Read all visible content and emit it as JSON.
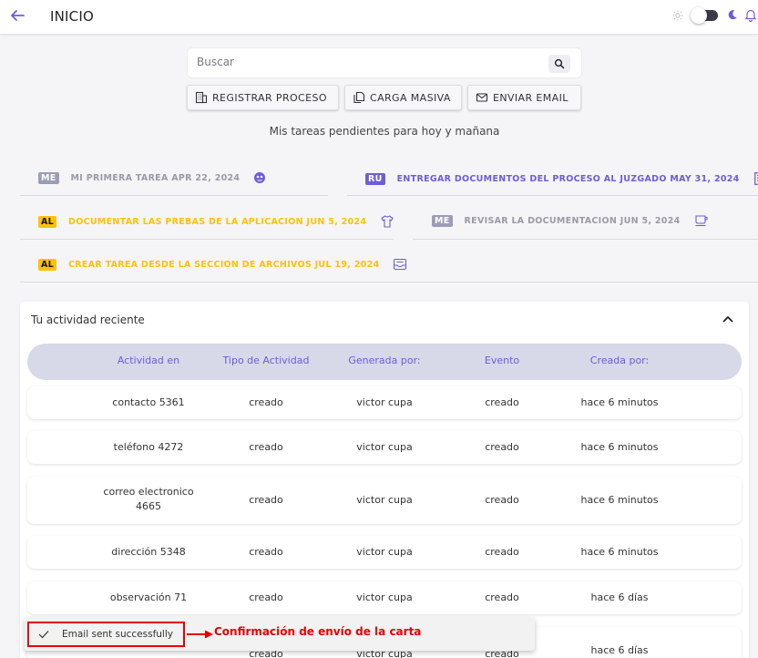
{
  "header": {
    "title": "INICIO"
  },
  "search": {
    "placeholder": "Buscar"
  },
  "actions": [
    {
      "label": "REGISTRAR PROCESO",
      "icon": "building-icon"
    },
    {
      "label": "CARGA MASIVA",
      "icon": "documents-icon"
    },
    {
      "label": "ENVIAR EMAIL",
      "icon": "envelope-icon"
    }
  ],
  "pending_title": "Mis tareas pendientes para hoy y mañana",
  "tasks": [
    {
      "badge": "ME",
      "text": "MI PRIMERA TAREA APR 22, 2024",
      "icon": "face-icon"
    },
    {
      "badge": "RU",
      "text": "ENTREGAR DOCUMENTOS DEL PROCESO AL JUZGADO MAY 31, 2024",
      "icon": "building-icon"
    },
    {
      "badge": "AL",
      "text": "DOCUMENTAR LAS PREBAS DE LA APLICACION JUN 5, 2024",
      "icon": "shirt-icon"
    },
    {
      "badge": "ME",
      "text": "REVISAR LA DOCUMENTACION JUN 5, 2024",
      "icon": "cup-icon"
    },
    {
      "badge": "AL",
      "text": "CREAR TAREA DESDE LA SECCION DE ARCHIVOS JUL 19, 2024",
      "icon": "inbox-icon"
    }
  ],
  "activity": {
    "title": "Tu actividad reciente",
    "columns": [
      "Actividad en",
      "Tipo de Actividad",
      "Generada por:",
      "Evento",
      "Creada por:"
    ],
    "rows": [
      [
        "contacto 5361",
        "creado",
        "victor cupa",
        "creado",
        "hace 6 minutos"
      ],
      [
        "teléfono 4272",
        "creado",
        "victor cupa",
        "creado",
        "hace 6 minutos"
      ],
      [
        "correo electronico 4665",
        "creado",
        "victor cupa",
        "creado",
        "hace 6 minutos"
      ],
      [
        "dirección 5348",
        "creado",
        "victor cupa",
        "creado",
        "hace 6 minutos"
      ],
      [
        "observación 71",
        "creado",
        "victor cupa",
        "creado",
        "hace 6 días"
      ],
      [
        "",
        "creado",
        "victor cupa",
        "creado",
        "hace 6 días"
      ]
    ]
  },
  "snackbar": {
    "message": "Email sent successfully"
  },
  "annotation": {
    "text": "Confirmación de envío de la carta",
    "color": "#e60000"
  },
  "colors": {
    "accent": "#6d5dd6",
    "warning": "#ffc107",
    "muted": "#9c9cb6"
  }
}
